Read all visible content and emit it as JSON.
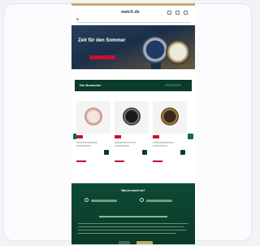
{
  "site": {
    "logo": "watch.de"
  },
  "hero": {
    "title": "Zeit für den Sommer",
    "cta_label": "",
    "colors": {
      "cta": "#c8102e"
    }
  },
  "section": {
    "title": "Die Bestseller"
  },
  "products": [
    {
      "name": "",
      "image": "rose-gold-watch"
    },
    {
      "name": "",
      "image": "black-dial-watch"
    },
    {
      "name": "",
      "image": "brown-dial-watch"
    }
  ],
  "footer": {
    "title": "Warum watch.de?"
  },
  "colors": {
    "brand": "#0b3b2a",
    "accent": "#c9a96b",
    "sale": "#c8102e"
  }
}
